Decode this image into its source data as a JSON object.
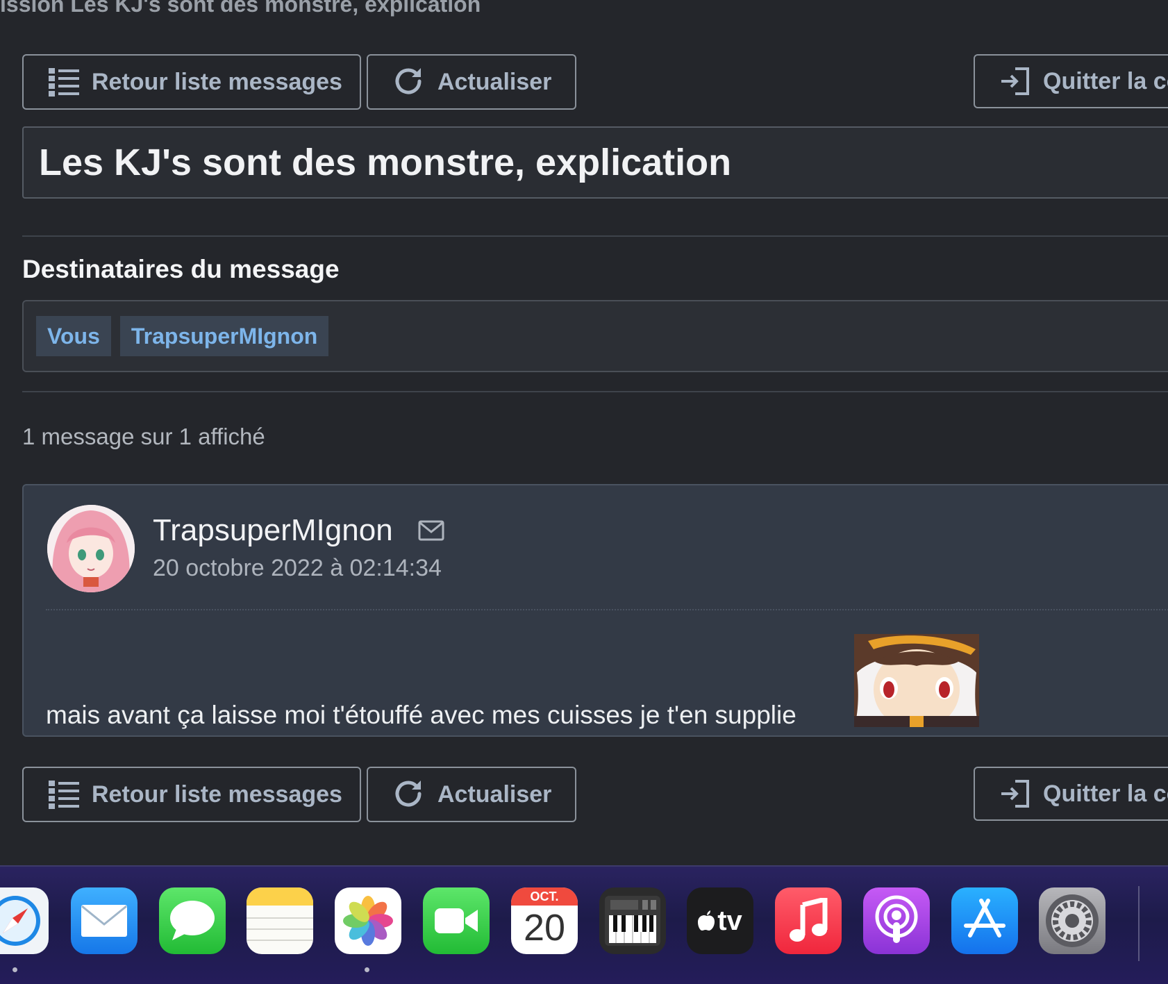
{
  "breadcrumb": "ission Les KJ's sont des monstre, explication",
  "toolbar": {
    "back_label": "Retour liste messages",
    "refresh_label": "Actualiser",
    "quit_label": "Quitter la co"
  },
  "conversation_title": "Les KJ's sont des monstre, explication",
  "recipients": {
    "heading": "Destinataires du message",
    "tags": [
      "Vous",
      "TrapsuperMIgnon"
    ]
  },
  "message_count": "1 message sur 1 affiché",
  "message": {
    "author": "TrapsuperMIgnon",
    "date": "20 octobre 2022 à 02:14:34",
    "body": "mais avant ça laisse moi t'étouffé avec mes cuisses je t'en supplie"
  },
  "dock": {
    "calendar_month": "OCT.",
    "calendar_day": "20",
    "tv_label": "tv",
    "apps": [
      "safari-icon",
      "mail-icon",
      "messages-icon",
      "notes-icon",
      "photos-icon",
      "facetime-icon",
      "calendar-icon",
      "piano-icon",
      "apple-tv-icon",
      "music-icon",
      "podcasts-icon",
      "app-store-icon",
      "system-preferences-icon"
    ]
  },
  "colors": {
    "background": "#24262b",
    "button_text": "#aab6c6",
    "tag_text": "#7db5ea",
    "card_bg": "#333a46"
  }
}
